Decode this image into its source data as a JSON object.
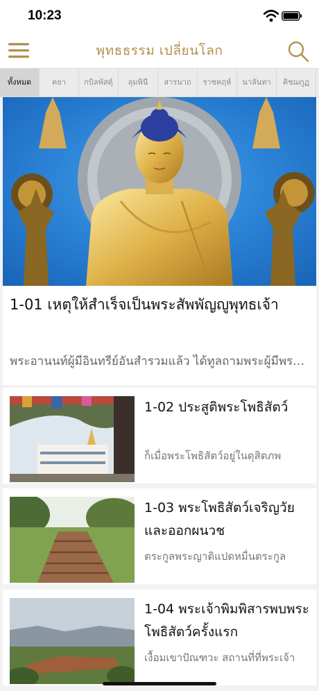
{
  "status_bar": {
    "time": "10:23"
  },
  "header": {
    "title": "พุทธธรรม เปลี่ยนโลก"
  },
  "tabs": [
    {
      "label": "ทั้งหมด",
      "active": true
    },
    {
      "label": "คยา",
      "active": false
    },
    {
      "label": "กบิลพัสดุ์",
      "active": false
    },
    {
      "label": "ลุมพินี",
      "active": false
    },
    {
      "label": "สารนาถ",
      "active": false
    },
    {
      "label": "ราชคฤห์",
      "active": false
    },
    {
      "label": "นาลันทา",
      "active": false
    },
    {
      "label": "คิชฌกูฏ",
      "active": false
    }
  ],
  "featured": {
    "title": "1-01 เหตุให้สำเร็จเป็นพระสัพพัญญูพุทธเจ้า",
    "excerpt": "พระอานนท์ผู้มีอินทรีย์อันสำรวมแล้ว ได้ทูลถามพระผู้มีพระภาค"
  },
  "articles": [
    {
      "title": "1-02 ประสูติพระโพธิสัตว์",
      "excerpt": "ก็เมื่อพระโพธิสัตว์อยู่ในดุสิตภพ"
    },
    {
      "title": "1-03 พระโพธิสัตว์เจริญวัยและออกผนวช",
      "excerpt": "ตระกูลพระญาติแปดหมื่นตระกูล"
    },
    {
      "title": "1-04 พระเจ้าพิมพิสารพบพระโพธิสัตว์ครั้งแรก",
      "excerpt": "เงื้อมเขาปัณฑวะ สถานที่ที่พระเจ้า"
    }
  ],
  "colors": {
    "accent": "#b29150",
    "hero_bg": "#1f7ad1"
  },
  "icons": [
    "menu-icon",
    "search-icon",
    "wifi-icon",
    "battery-icon"
  ]
}
